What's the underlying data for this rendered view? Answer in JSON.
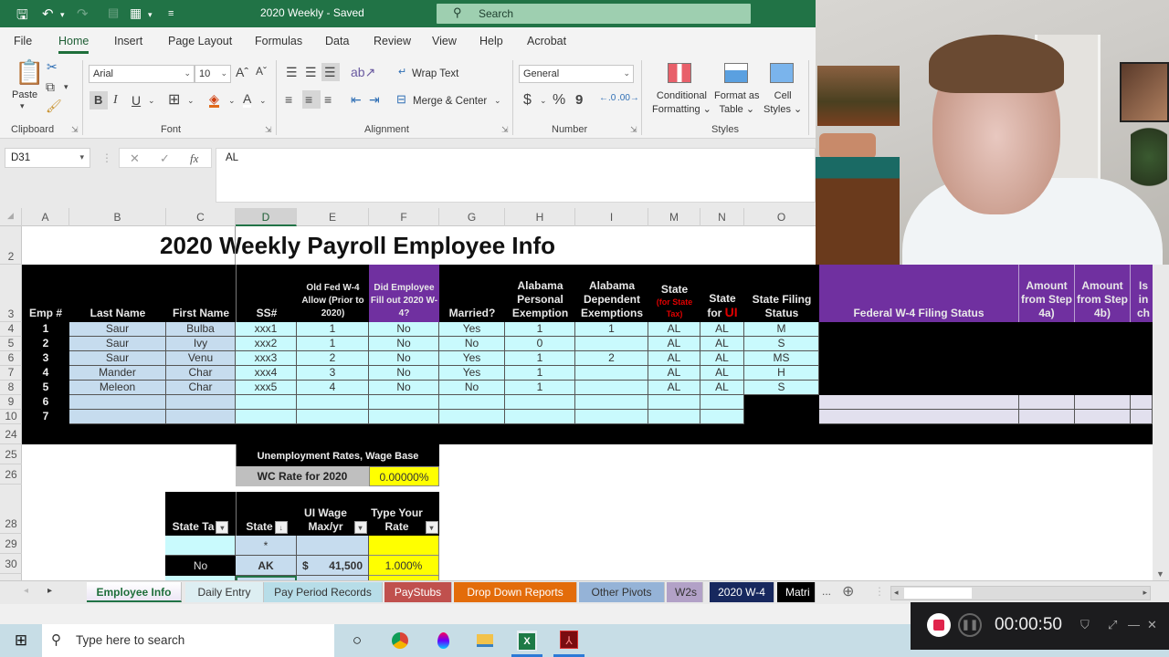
{
  "titlebar": {
    "title": "2020 Weekly  -  Saved",
    "search_placeholder": "Search",
    "icons": [
      "save-icon",
      "undo-icon",
      "redo-icon",
      "clipboard-icon",
      "form-icon",
      "customize-icon"
    ]
  },
  "menu": {
    "tabs": [
      "File",
      "Home",
      "Insert",
      "Page Layout",
      "Formulas",
      "Data",
      "Review",
      "View",
      "Help",
      "Acrobat"
    ],
    "active": "Home"
  },
  "ribbon": {
    "clipboard": {
      "label": "Clipboard",
      "paste": "Paste"
    },
    "font": {
      "label": "Font",
      "font_name": "Arial",
      "font_size": "10",
      "bold": "B",
      "italic": "I",
      "underline": "U"
    },
    "alignment": {
      "label": "Alignment",
      "wrap_text": "Wrap Text",
      "merge_center": "Merge & Center"
    },
    "number": {
      "label": "Number",
      "format": "General",
      "currency": "$",
      "percent": "%",
      "comma": "9"
    },
    "styles": {
      "label": "Styles",
      "conditional": "Conditional",
      "conditional2": "Formatting",
      "format_table": "Format as",
      "format_table2": "Table",
      "cell_styles": "Cell",
      "cell_styles2": "Styles"
    }
  },
  "formula_bar": {
    "name_box": "D31",
    "formula": "AL",
    "cancel": "✕",
    "enter": "✓",
    "fx": "fx"
  },
  "columns": [
    "A",
    "B",
    "C",
    "D",
    "E",
    "F",
    "G",
    "H",
    "I",
    "M",
    "N",
    "O"
  ],
  "selected_column": "D",
  "rows": [
    "2",
    "3",
    "4",
    "5",
    "6",
    "7",
    "8",
    "9",
    "10",
    "24",
    "25",
    "26",
    "28",
    "29",
    "30"
  ],
  "sheet": {
    "title": "2020 Weekly Payroll Employee Info",
    "headers": {
      "emp": "Emp #",
      "last": "Last Name",
      "first": "First Name",
      "ss": "SS#",
      "old_w4": "Old Fed W-4 Allow (Prior to 2020)",
      "did_fill": "Did Employee Fill out 2020 W-4?",
      "married": "Married?",
      "al_personal": "Alabama Personal Exemption",
      "al_dependent": "Alabama Dependent Exemptions",
      "state_tax_1": "State",
      "state_tax_2": "(for State Tax)",
      "state_ui_1": "State",
      "state_ui_2": "for",
      "state_ui_3": "UI",
      "state_filing": "State Filing Status",
      "fed_filing": "Federal W-4 Filing Status",
      "step4a": "Amount from Step 4a)",
      "step4b": "Amount from Step 4b)",
      "is_in": "Is in ch"
    },
    "employees": [
      {
        "emp": "1",
        "last": "Saur",
        "first": "Bulba",
        "ss": "xxx1",
        "old_w4": "1",
        "did_fill": "No",
        "married": "Yes",
        "al_personal": "1",
        "al_dependent": "1",
        "state_tax": "AL",
        "state_ui": "AL",
        "state_filing": "M"
      },
      {
        "emp": "2",
        "last": "Saur",
        "first": "Ivy",
        "ss": "xxx2",
        "old_w4": "1",
        "did_fill": "No",
        "married": "No",
        "al_personal": "0",
        "al_dependent": "",
        "state_tax": "AL",
        "state_ui": "AL",
        "state_filing": "S"
      },
      {
        "emp": "3",
        "last": "Saur",
        "first": "Venu",
        "ss": "xxx3",
        "old_w4": "2",
        "did_fill": "No",
        "married": "Yes",
        "al_personal": "1",
        "al_dependent": "2",
        "state_tax": "AL",
        "state_ui": "AL",
        "state_filing": "MS"
      },
      {
        "emp": "4",
        "last": "Mander",
        "first": "Char",
        "ss": "xxx4",
        "old_w4": "3",
        "did_fill": "No",
        "married": "Yes",
        "al_personal": "1",
        "al_dependent": "",
        "state_tax": "AL",
        "state_ui": "AL",
        "state_filing": "H"
      },
      {
        "emp": "5",
        "last": "Meleon",
        "first": "Char",
        "ss": "xxx5",
        "old_w4": "4",
        "did_fill": "No",
        "married": "No",
        "al_personal": "1",
        "al_dependent": "",
        "state_tax": "AL",
        "state_ui": "AL",
        "state_filing": "S"
      },
      {
        "emp": "6"
      },
      {
        "emp": "7"
      }
    ],
    "unemployment": {
      "title": "Unemployment Rates, Wage Base",
      "wc_label": "WC Rate for 2020",
      "wc_value": "0.00000%",
      "headers": {
        "state_tax": "State Ta",
        "state": "State",
        "ui_wage": "UI Wage Max/yr",
        "rate": "Type Your Rate"
      },
      "rows": [
        {
          "state_tax": "",
          "state": "*",
          "ui_dollar": "",
          "ui_wage": "",
          "rate": ""
        },
        {
          "state_tax": "No",
          "state": "AK",
          "ui_dollar": "$",
          "ui_wage": "41,500",
          "rate": "1.000%"
        }
      ]
    }
  },
  "sheet_tabs": [
    {
      "label": "Employee Info",
      "color": "#ece6f5",
      "active": true
    },
    {
      "label": "Daily Entry",
      "color": "#ddeef2"
    },
    {
      "label": "Pay Period Records",
      "color": "#b7dde8"
    },
    {
      "label": "PayStubs",
      "color": "#c0504d"
    },
    {
      "label": "Drop Down Reports",
      "color": "#e36c0a"
    },
    {
      "label": "Other Pivots",
      "color": "#95b3d7"
    },
    {
      "label": "W2s",
      "color": "#b2a1c7"
    },
    {
      "label": "2020 W-4",
      "color": "#17285e"
    },
    {
      "label": "Matri",
      "color": "#000000"
    }
  ],
  "sheet_more": "...",
  "taskbar": {
    "search_placeholder": "Type here to search",
    "apps": [
      "cortana-icon",
      "chrome-icon",
      "paint3d-icon",
      "file-explorer-icon",
      "excel-icon",
      "acrobat-icon"
    ]
  },
  "recorder": {
    "time": "00:00:50"
  },
  "colors": {
    "excel_green": "#217346",
    "header_purple": "#7030a0",
    "cell_cyan": "#c9fafd",
    "cell_blue": "#c6dcee",
    "yellow": "#ffff00"
  }
}
